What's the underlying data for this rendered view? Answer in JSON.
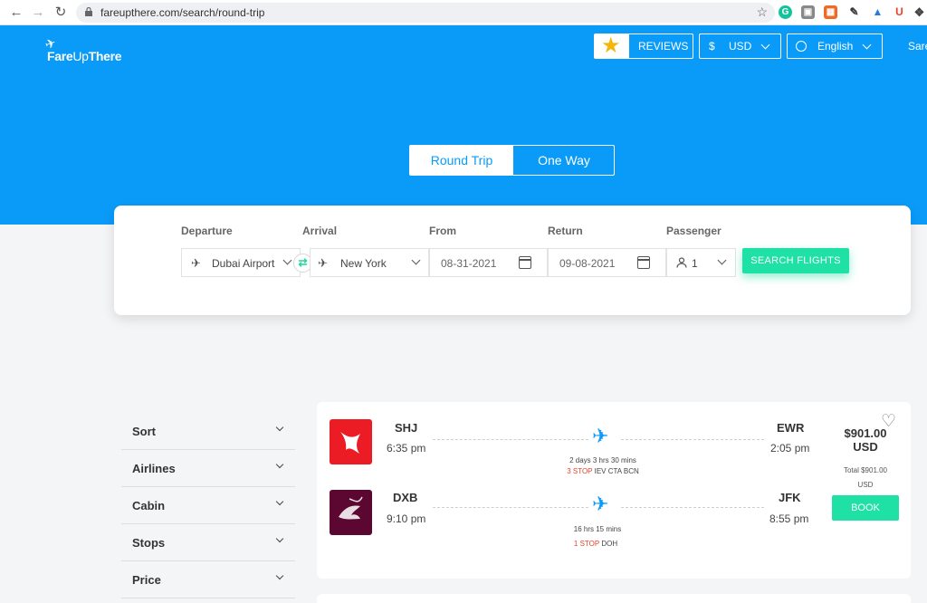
{
  "browser": {
    "url": "fareupthere.com/search/round-trip"
  },
  "header": {
    "logo_text_bold": "Fare",
    "logo_text_thin": "Up",
    "logo_text_end": "There",
    "reviews_label": "REVIEWS",
    "currency_symbol": "$",
    "currency_label": "USD",
    "language_label": "English",
    "share_label": "Sare"
  },
  "trip_type": {
    "round_trip": "Round Trip",
    "one_way": "One Way",
    "selected": "Round Trip"
  },
  "search": {
    "departure_label": "Departure",
    "arrival_label": "Arrival",
    "from_label": "From",
    "return_label": "Return",
    "passenger_label": "Passenger",
    "departure_value": "Dubai Airport",
    "arrival_value": "New York",
    "from_value": "08-31-2021",
    "return_value": "09-08-2021",
    "passenger_value": "1",
    "search_button": "SEARCH FLIGHTS"
  },
  "filters": [
    {
      "label": "Sort"
    },
    {
      "label": "Airlines"
    },
    {
      "label": "Cabin"
    },
    {
      "label": "Stops"
    },
    {
      "label": "Price"
    }
  ],
  "result": {
    "outbound": {
      "from_code": "SHJ",
      "from_time": "6:35 pm",
      "to_code": "EWR",
      "to_time": "2:05 pm",
      "duration": "2 days 3 hrs 30 mins",
      "stop_count": "3 STOP",
      "stop_airports": "IEV CTA BCN"
    },
    "return": {
      "from_code": "DXB",
      "from_time": "9:10 pm",
      "to_code": "JFK",
      "to_time": "8:55 pm",
      "duration": "16 hrs 15 mins",
      "stop_count": "1 STOP",
      "stop_airports": "DOH"
    },
    "price": "$901.00",
    "price_currency": "USD",
    "total_line": "Total $901.00",
    "total_currency": "USD",
    "book_label": "BOOK"
  },
  "colors": {
    "brand_blue": "#0a9bf9",
    "accent_green": "#1fe0a5",
    "stop_red": "#e8412c"
  }
}
